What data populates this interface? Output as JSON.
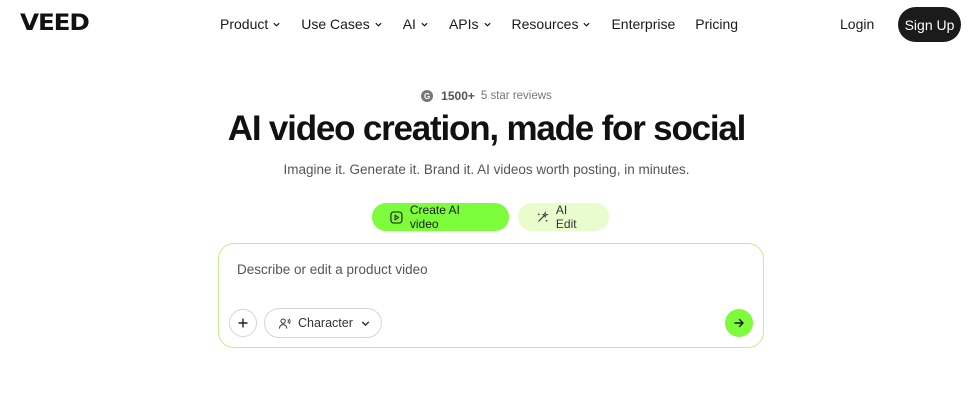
{
  "nav": {
    "logo": "VEED",
    "items": [
      {
        "label": "Product",
        "has_dropdown": true
      },
      {
        "label": "Use Cases",
        "has_dropdown": true
      },
      {
        "label": "AI",
        "has_dropdown": true
      },
      {
        "label": "APIs",
        "has_dropdown": true
      },
      {
        "label": "Resources",
        "has_dropdown": true
      },
      {
        "label": "Enterprise",
        "has_dropdown": false
      },
      {
        "label": "Pricing",
        "has_dropdown": false
      }
    ],
    "login": "Login",
    "signup": "Sign Up"
  },
  "hero": {
    "reviews_count": "1500+",
    "reviews_text": "5 star reviews",
    "headline": "AI video creation, made for social",
    "subline": "Imagine it. Generate it. Brand it. AI videos worth posting, in minutes."
  },
  "modes": {
    "primary": {
      "label": "Create AI video",
      "icon": "play-square-icon"
    },
    "secondary": {
      "label": "AI Edit",
      "icon": "magic-wand-icon"
    }
  },
  "prompt": {
    "placeholder": "Describe or edit a product video",
    "value": "",
    "character_label": "Character",
    "add_icon": "plus-icon",
    "send_icon": "arrow-right-icon"
  },
  "colors": {
    "accent": "#7dfc3c",
    "accent_soft": "#e9fccd",
    "dark": "#1b1b1b",
    "prompt_border": "#c4f08f"
  }
}
